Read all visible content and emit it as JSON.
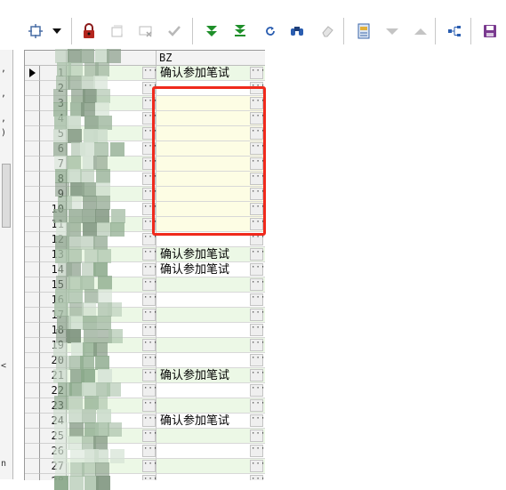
{
  "toolbar": {
    "buttons": [
      {
        "name": "drag-select-button",
        "icon": "drag-handle-icon",
        "enabled": true
      },
      {
        "name": "dropdown-arrow-button",
        "icon": "caret-down-icon",
        "enabled": true
      },
      {
        "name": "lock-button",
        "icon": "lock-icon",
        "enabled": true
      },
      {
        "name": "new-record-button",
        "icon": "new-record-icon",
        "enabled": false
      },
      {
        "name": "cancel-edit-button",
        "icon": "cancel-edit-icon",
        "enabled": false
      },
      {
        "name": "confirm-button",
        "icon": "checkmark-icon",
        "enabled": false
      },
      {
        "name": "move-down-button",
        "icon": "arrow-down-double-icon",
        "enabled": true
      },
      {
        "name": "move-to-bottom-button",
        "icon": "arrow-to-bottom-icon",
        "enabled": true
      },
      {
        "name": "refresh-button",
        "icon": "refresh-icon",
        "enabled": true
      },
      {
        "name": "find-button",
        "icon": "binoculars-icon",
        "enabled": true
      },
      {
        "name": "clear-button",
        "icon": "eraser-icon",
        "enabled": false
      },
      {
        "name": "report-button",
        "icon": "report-icon",
        "enabled": true
      },
      {
        "name": "sort-descending-button",
        "icon": "triangle-down-icon",
        "enabled": false
      },
      {
        "name": "sort-ascending-button",
        "icon": "triangle-up-icon",
        "enabled": false
      },
      {
        "name": "tree-view-button",
        "icon": "tree-icon",
        "enabled": true
      },
      {
        "name": "save-button",
        "icon": "floppy-disk-icon",
        "enabled": true
      }
    ]
  },
  "left_panel": {
    "marks": [
      ",",
      ",",
      ",",
      ")",
      "",
      "",
      "",
      "",
      "",
      "",
      "",
      "",
      "",
      "<",
      "",
      "n"
    ]
  },
  "grid": {
    "columns": [
      {
        "key": "num",
        "label": ""
      },
      {
        "key": "hidden",
        "label": ""
      },
      {
        "key": "bz",
        "label": "BZ"
      }
    ],
    "rows": [
      {
        "num": "1",
        "bz": "确认参加笔试",
        "current": true
      },
      {
        "num": "2",
        "bz": ""
      },
      {
        "num": "3",
        "bz": ""
      },
      {
        "num": "4",
        "bz": ""
      },
      {
        "num": "5",
        "bz": ""
      },
      {
        "num": "6",
        "bz": ""
      },
      {
        "num": "7",
        "bz": ""
      },
      {
        "num": "8",
        "bz": ""
      },
      {
        "num": "9",
        "bz": ""
      },
      {
        "num": "10",
        "bz": ""
      },
      {
        "num": "11",
        "bz": ""
      },
      {
        "num": "12",
        "bz": ""
      },
      {
        "num": "13",
        "bz": "确认参加笔试"
      },
      {
        "num": "14",
        "bz": "确认参加笔试"
      },
      {
        "num": "15",
        "bz": ""
      },
      {
        "num": "16",
        "bz": ""
      },
      {
        "num": "17",
        "bz": ""
      },
      {
        "num": "18",
        "bz": ""
      },
      {
        "num": "19",
        "bz": ""
      },
      {
        "num": "20",
        "bz": ""
      },
      {
        "num": "21",
        "bz": "确认参加笔试"
      },
      {
        "num": "22",
        "bz": ""
      },
      {
        "num": "23",
        "bz": ""
      },
      {
        "num": "24",
        "bz": "确认参加笔试"
      },
      {
        "num": "25",
        "bz": ""
      },
      {
        "num": "26",
        "bz": ""
      },
      {
        "num": "27",
        "bz": ""
      },
      {
        "num": "28",
        "bz": ""
      }
    ],
    "ellipsis": "···"
  },
  "colors": {
    "row_green": "#ecf8e6",
    "row_white": "#ffffff",
    "row_yellow": "#fdfde4",
    "highlight": "#f02a1c"
  }
}
